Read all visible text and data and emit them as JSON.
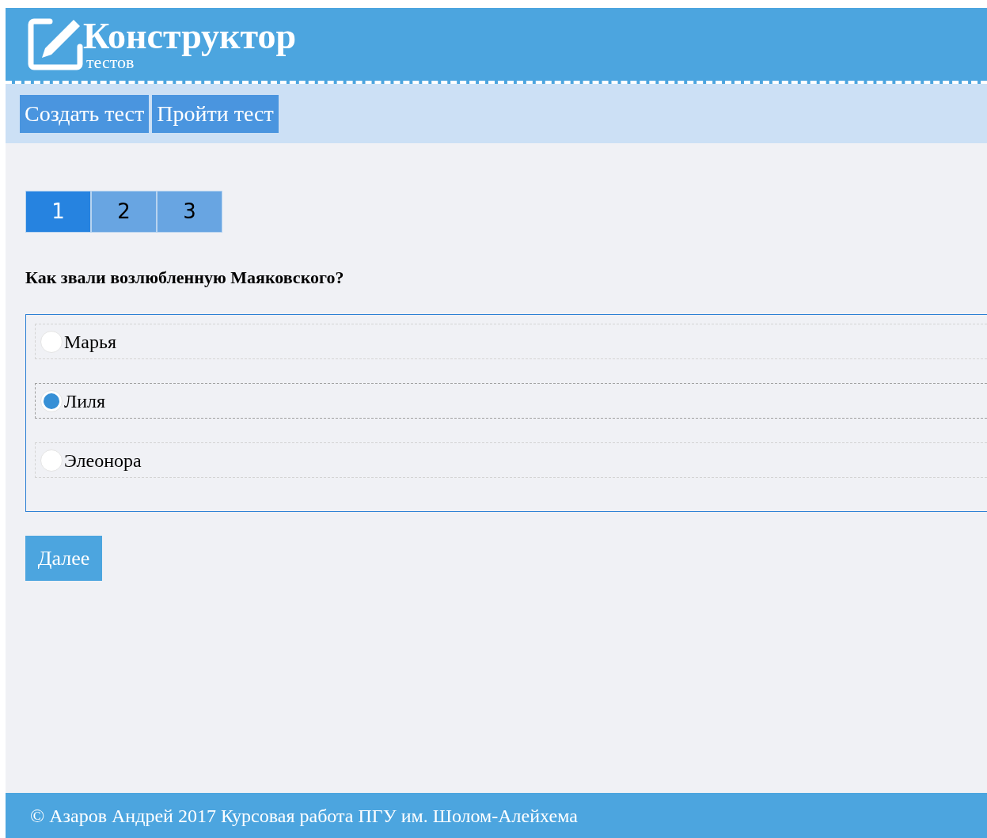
{
  "logo": {
    "title": "Конструктор",
    "subtitle": "тестов"
  },
  "nav": [
    {
      "label": "Создать тест"
    },
    {
      "label": "Пройти тест"
    }
  ],
  "question_tabs": [
    {
      "label": "1",
      "selected": true
    },
    {
      "label": "2",
      "selected": false
    },
    {
      "label": "3",
      "selected": false
    }
  ],
  "question": "Как звали возлюбленную Маяковского?",
  "options": [
    {
      "label": "Марья",
      "selected": false
    },
    {
      "label": "Лиля",
      "selected": true
    },
    {
      "label": "Элеонора",
      "selected": false
    }
  ],
  "next_button": "Далее",
  "footer": "© Азаров Андрей 2017 Курсовая работа ПГУ им. Шолом-Алейхема"
}
